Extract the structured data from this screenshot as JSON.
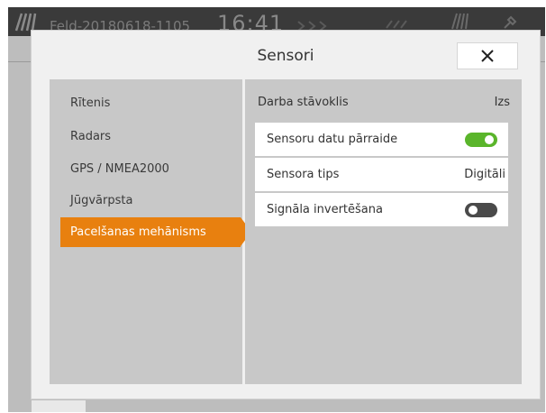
{
  "status_bar": {
    "field_name": "Feld-20180618-1105",
    "clock": "16:41",
    "icons": [
      "field-icon",
      "arrows-icon",
      "signal-icon",
      "gps-icon"
    ]
  },
  "dialog": {
    "title": "Sensori",
    "close_label": "✕"
  },
  "sidebar": {
    "items": [
      {
        "label": "Rītenis",
        "active": false
      },
      {
        "label": "Radars",
        "active": false
      },
      {
        "label": "GPS / NMEA2000",
        "active": false
      },
      {
        "label": "Jūgvārpsta",
        "active": false
      },
      {
        "label": "Pacelšanas mehānisms",
        "active": true
      }
    ]
  },
  "content": {
    "work_state": {
      "label": "Darba stāvoklis",
      "value": "Izs"
    },
    "settings": [
      {
        "label": "Sensoru datu pārraide",
        "control": "toggle",
        "on": true
      },
      {
        "label": "Sensora tips",
        "control": "value",
        "value": "Digitāli"
      },
      {
        "label": "Signāla invertēšana",
        "control": "toggle",
        "on": false
      }
    ]
  },
  "colors": {
    "accent": "#e8800f",
    "toggle_on": "#5ab52b",
    "toggle_off": "#4a4a4a"
  }
}
